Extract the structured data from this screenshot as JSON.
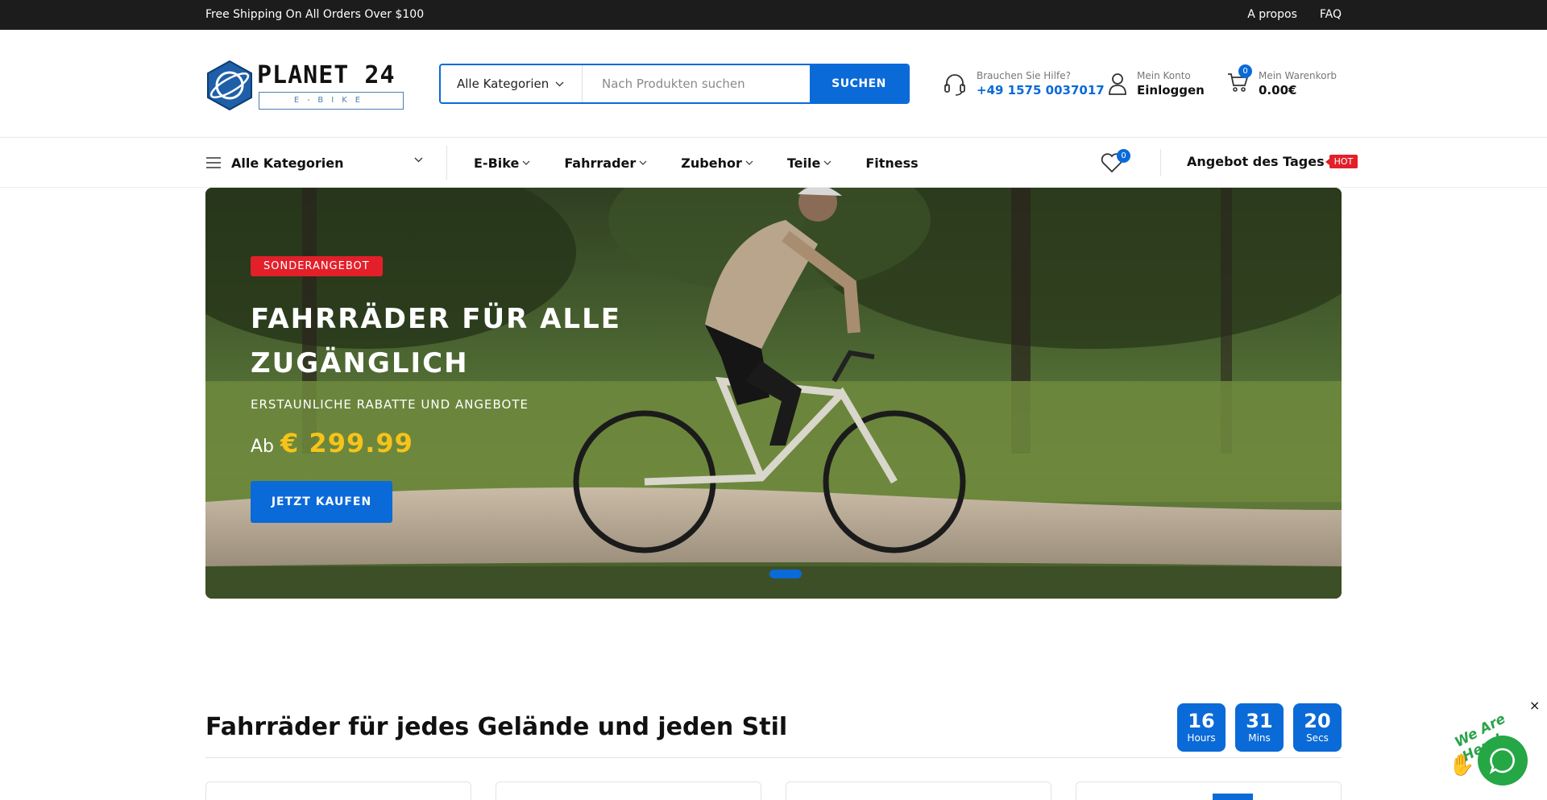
{
  "topbar": {
    "shipping": "Free Shipping On All Orders Over $100",
    "links": [
      "A propos",
      "FAQ"
    ]
  },
  "logo": {
    "name": "PLANET 24",
    "sub": "E-BIKE"
  },
  "search": {
    "category": "Alle Kategorien",
    "placeholder": "Nach Produkten suchen",
    "button": "SUCHEN"
  },
  "help": {
    "label": "Brauchen Sie Hilfe?",
    "phone": "+49 1575 0037017"
  },
  "account": {
    "label": "Mein Konto",
    "action": "Einloggen"
  },
  "cart": {
    "label": "Mein Warenkorb",
    "total": "0.00€",
    "count": "0"
  },
  "nav": {
    "all_categories": "Alle Kategorien",
    "items": [
      "E-Bike",
      "Fahrrader",
      "Zubehor",
      "Teile",
      "Fitness"
    ],
    "wishlist_count": "0",
    "deal": "Angebot des Tages",
    "hot": "HOT"
  },
  "hero": {
    "tag": "SONDERANGEBOT",
    "title": "FAHRRÄDER FÜR ALLE ZUGÄNGLICH",
    "subtitle": "ERSTAUNLICHE RABATTE UND ANGEBOTE",
    "price_prefix": "Ab",
    "price": "€ 299.99",
    "button": "JETZT KAUFEN"
  },
  "section": {
    "title": "Fahrräder für jedes Gelände und jeden Stil",
    "timer": [
      {
        "value": "16",
        "label": "Hours"
      },
      {
        "value": "31",
        "label": "Mins"
      },
      {
        "value": "20",
        "label": "Secs"
      }
    ]
  },
  "chat": {
    "text": "We Are Here!",
    "close": "×"
  },
  "colors": {
    "brand": "#0a6ad8",
    "hot": "#e3202a",
    "price": "#f7c31a",
    "topbar": "#1c1c1c",
    "chat": "#25a745"
  }
}
